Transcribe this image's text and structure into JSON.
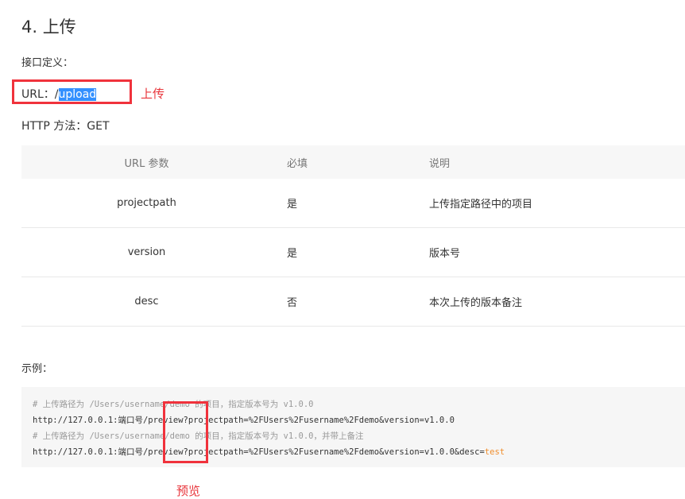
{
  "title": "4. 上传",
  "interface_label": "接口定义：",
  "url_label": "URL：",
  "url_prefix": "/",
  "url_selected": "upload",
  "annotation_upload": "上传",
  "http_method": "HTTP 方法：GET",
  "table": {
    "headers": [
      "URL 参数",
      "必填",
      "说明"
    ],
    "rows": [
      [
        "projectpath",
        "是",
        "上传指定路径中的项目"
      ],
      [
        "version",
        "是",
        "版本号"
      ],
      [
        "desc",
        "否",
        "本次上传的版本备注"
      ]
    ]
  },
  "example_label": "示例：",
  "code": {
    "line1": "# 上传路径为 /Users/username/demo 的项目，指定版本号为 v1.0.0",
    "line2": "http://127.0.0.1:端口号/preview?projectpath=%2FUsers%2Fusername%2Fdemo&version=v1.0.0",
    "line3": "# 上传路径为 /Users/username/demo 的项目，指定版本号为 v1.0.0，并带上备注",
    "line4a": "http://127.0.0.1:端口号/preview?projectpath=%2FUsers%2Fusername%2Fdemo&version=v1.0.0&desc=",
    "line4b": "test"
  },
  "annotation_preview": "预览",
  "colors": {
    "annotation": "#e8353b",
    "selection": "#3390ff",
    "string": "#f08d2c"
  }
}
